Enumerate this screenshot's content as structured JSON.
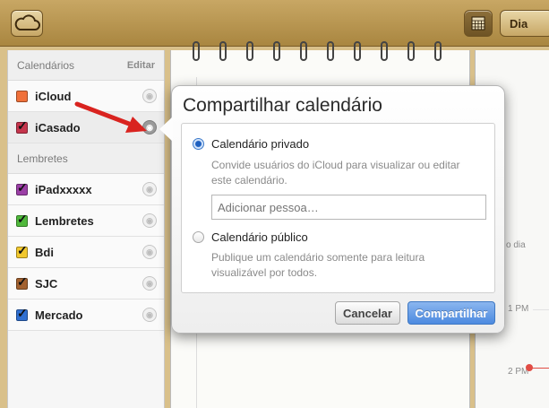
{
  "toolbar": {
    "view_day_label": "Dia"
  },
  "sidebar": {
    "calendars_header": "Calendários",
    "edit_label": "Editar",
    "calendars": [
      {
        "label": "iCloud",
        "color": "#f0703a",
        "checked": false
      },
      {
        "label": "iCasado",
        "color": "#c5354c",
        "checked": true
      }
    ],
    "reminders_header": "Lembretes",
    "reminders": [
      {
        "label": "iPadxxxxx",
        "color": "#9b3fa6",
        "checked": true
      },
      {
        "label": "Lembretes",
        "color": "#4fb83b",
        "checked": true
      },
      {
        "label": "Bdi",
        "color": "#f2c82e",
        "checked": true
      },
      {
        "label": "SJC",
        "color": "#a2612f",
        "checked": true
      },
      {
        "label": "Mercado",
        "color": "#2f6fd1",
        "checked": true
      }
    ]
  },
  "timeline": {
    "label_1": "o dia",
    "label_2": "1 PM",
    "label_3": "2 PM"
  },
  "share_popover": {
    "title": "Compartilhar calendário",
    "private_option": "Calendário privado",
    "private_desc": "Convide usuários do iCloud para visualizar ou editar este calendário.",
    "invite_placeholder": "Adicionar pessoa…",
    "public_option": "Calendário público",
    "public_desc": "Publique um calendário somente para leitura visualizável por todos.",
    "cancel_label": "Cancelar",
    "share_label": "Compartilhar"
  },
  "colors": {
    "accent_blue": "#4c8ae0",
    "annotation_red": "#e02020"
  }
}
